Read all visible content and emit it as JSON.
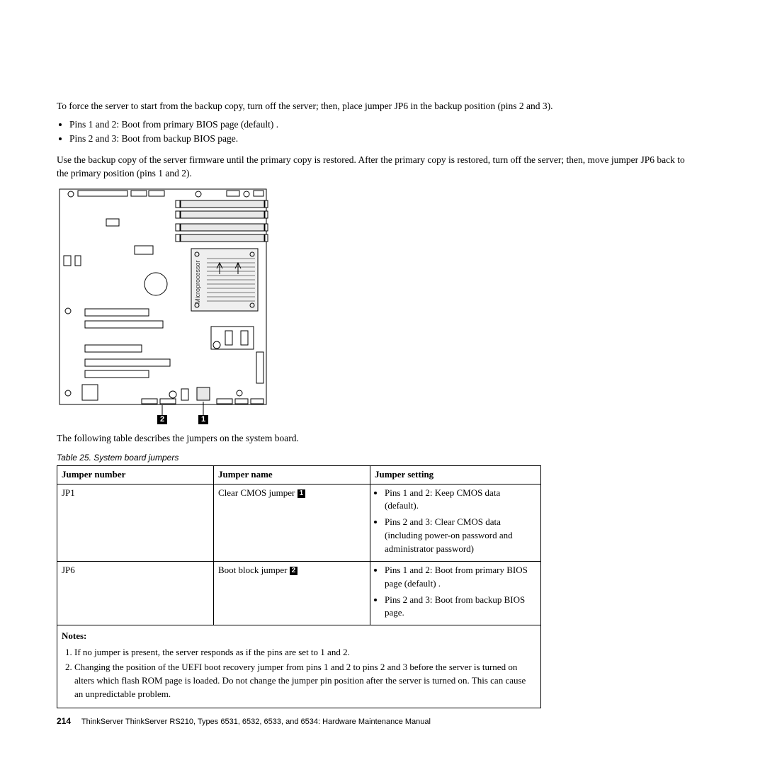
{
  "intro": {
    "p1": "To force the server to start from the backup copy, turn off the server; then, place jumper JP6 in the backup position (pins 2 and 3).",
    "b1": "Pins 1 and 2: Boot from primary BIOS page (default) .",
    "b2": "Pins 2 and 3: Boot from backup BIOS page.",
    "p2": "Use the backup copy of the server firmware until the primary copy is restored. After the primary copy is restored, turn off the server; then, move jumper JP6 back to the primary position (pins 1 and 2)."
  },
  "diagram": {
    "micro_label": "Microprocessor",
    "callout1": "1",
    "callout2": "2"
  },
  "table_intro": "The following table describes the jumpers on the system board.",
  "table_caption": "Table 25. System board jumpers",
  "table": {
    "h1": "Jumper number",
    "h2": "Jumper name",
    "h3": "Jumper setting",
    "r1c1": "JP1",
    "r1c2a": "Clear CMOS jumper ",
    "r1c2b": "1",
    "r1c3a": "Pins 1 and 2: Keep CMOS data (default).",
    "r1c3b": "Pins 2 and 3: Clear CMOS data (including power-on password and administrator password)",
    "r2c1": "JP6",
    "r2c2a": "Boot block jumper ",
    "r2c2b": "2",
    "r2c3a": "Pins 1 and 2: Boot from primary BIOS page (default) .",
    "r2c3b": "Pins 2 and 3: Boot from backup BIOS page."
  },
  "notes": {
    "heading": "Notes:",
    "n1": "If no jumper is present, the server responds as if the pins are set to 1 and 2.",
    "n2": "Changing the position of the UEFI boot recovery jumper from pins 1 and 2 to pins 2 and 3 before the server is turned on alters which flash ROM page is loaded. Do not change the jumper pin position after the server is turned on. This can cause an unpredictable problem."
  },
  "footer": {
    "page": "214",
    "text": "ThinkServer ThinkServer RS210, Types 6531, 6532, 6533, and 6534: Hardware Maintenance Manual"
  }
}
